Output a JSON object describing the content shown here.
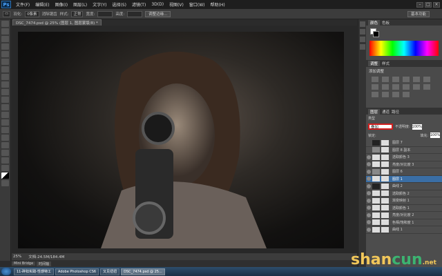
{
  "app": {
    "logo": "Ps"
  },
  "menu": [
    "文件(F)",
    "编辑(E)",
    "图像(I)",
    "图层(L)",
    "文字(Y)",
    "选择(S)",
    "滤镜(T)",
    "3D(D)",
    "视图(V)",
    "窗口(W)",
    "帮助(H)"
  ],
  "window_controls": [
    "–",
    "□",
    "×"
  ],
  "options": {
    "feather_label": "羽化:",
    "feather_value": "0像素",
    "antialias": "消除锯齿",
    "style_label": "样式:",
    "style_value": "正常",
    "width_label": "宽度:",
    "height_label": "高度:",
    "refine_edge": "调整边缘...",
    "workspace": "基本功能"
  },
  "document": {
    "tab": "DSC_7474.psd @ 25% (图层 1, 图层蒙版/8) *",
    "zoom": "25%",
    "doc_size": "文档:24.5M/184.4M"
  },
  "minibridge": [
    "Mini Bridge",
    "时间轴"
  ],
  "taskbar": [
    "11-碎扣实践-性感特工",
    "Adobe Photoshop CS6",
    "又见扭扭",
    "DSC_7474.psd @ 25..."
  ],
  "panels": {
    "color_tabs": [
      "颜色",
      "色板"
    ],
    "adjust_tabs": [
      "调整",
      "样式"
    ],
    "adjust_title": "添加调整",
    "layers_tabs": [
      "图层",
      "通道",
      "路径"
    ],
    "kind": "类型",
    "blend_mode": "叠加",
    "opacity_label": "不透明度:",
    "opacity_value": "100%",
    "lock_label": "锁定:",
    "fill_label": "填充:",
    "fill_value": "100%"
  },
  "layers": [
    {
      "name": "图层 7",
      "thumb": "dark",
      "visible": false,
      "selected": false
    },
    {
      "name": "图层 8 副本",
      "thumb": "group",
      "visible": false,
      "selected": false
    },
    {
      "name": "选取颜色 3",
      "thumb": "light",
      "visible": true,
      "selected": false
    },
    {
      "name": "亮度/对比度 3",
      "thumb": "light",
      "visible": true,
      "selected": false
    },
    {
      "name": "图层 6",
      "thumb": "group",
      "visible": true,
      "selected": false
    },
    {
      "name": "图层 1",
      "thumb": "light",
      "visible": true,
      "selected": true
    },
    {
      "name": "曲线 2",
      "thumb": "dark",
      "visible": true,
      "selected": false
    },
    {
      "name": "选取颜色 2",
      "thumb": "light",
      "visible": true,
      "selected": false
    },
    {
      "name": "渐变映射 1",
      "thumb": "light",
      "visible": true,
      "selected": false
    },
    {
      "name": "选取颜色 1",
      "thumb": "light",
      "visible": true,
      "selected": false
    },
    {
      "name": "亮度/对比度 2",
      "thumb": "light",
      "visible": true,
      "selected": false
    },
    {
      "name": "色相/饱和度 1",
      "thumb": "light",
      "visible": true,
      "selected": false
    },
    {
      "name": "曲线 1",
      "thumb": "light",
      "visible": true,
      "selected": false
    }
  ],
  "watermark": {
    "a": "shan",
    "b": "cun",
    "c": ".net"
  }
}
